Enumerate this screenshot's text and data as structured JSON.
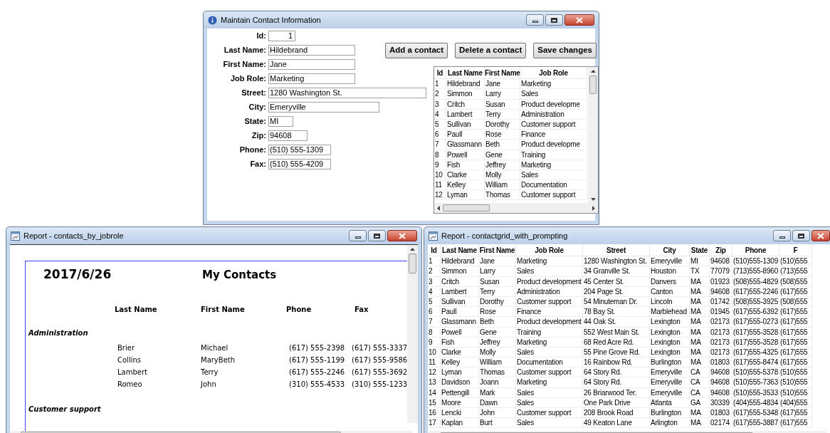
{
  "contact_form": {
    "title": "Maintain Contact Information",
    "fields": [
      {
        "label": "Id:",
        "value": "1",
        "kind": "number"
      },
      {
        "label": "Last Name:",
        "value": "Hildebrand",
        "kind": "text"
      },
      {
        "label": "First Name:",
        "value": "Jane",
        "kind": "text"
      },
      {
        "label": "Job Role:",
        "value": "Marketing",
        "kind": "text"
      },
      {
        "label": "Street:",
        "value": "1280 Washington St.",
        "kind": "text"
      },
      {
        "label": "City:",
        "value": "Emeryville",
        "kind": "text"
      },
      {
        "label": "State:",
        "value": "MI",
        "kind": "text"
      },
      {
        "label": "Zip:",
        "value": "94608",
        "kind": "text"
      },
      {
        "label": "Phone:",
        "value": "(510) 555-1309",
        "kind": "text"
      },
      {
        "label": "Fax:",
        "value": "(510) 555-4209",
        "kind": "text"
      }
    ],
    "buttons": [
      "Add a contact",
      "Delete a contact",
      "Save changes"
    ],
    "grid": {
      "columns": [
        "Id",
        "Last Name",
        "First Name",
        "Job Role"
      ],
      "rows": [
        [
          "1",
          "Hildebrand",
          "Jane",
          "Marketing"
        ],
        [
          "2",
          "Simmon",
          "Larry",
          "Sales"
        ],
        [
          "3",
          "Critch",
          "Susan",
          "Product developme"
        ],
        [
          "4",
          "Lambert",
          "Terry",
          "Administration"
        ],
        [
          "5",
          "Sullivan",
          "Dorothy",
          "Customer support"
        ],
        [
          "6",
          "Paull",
          "Rose",
          "Finance"
        ],
        [
          "7",
          "Glassmann",
          "Beth",
          "Product developme"
        ],
        [
          "8",
          "Powell",
          "Gene",
          "Training"
        ],
        [
          "9",
          "Fish",
          "Jeffrey",
          "Marketing"
        ],
        [
          "10",
          "Clarke",
          "Molly",
          "Sales"
        ],
        [
          "11",
          "Kelley",
          "William",
          "Documentation"
        ],
        [
          "12",
          "Lyman",
          "Thomas",
          "Customer support"
        ]
      ]
    }
  },
  "report_by_jobrole": {
    "title": "Report - contacts_by_jobrole",
    "date": "2017/6/26",
    "heading": "My Contacts",
    "columns": [
      "Last Name",
      "First Name",
      "Phone",
      "Fax"
    ],
    "groups": [
      {
        "name": "Administration",
        "rows": [
          [
            "Brier",
            "Michael",
            "(617) 555-2398",
            "(617) 555-3337"
          ],
          [
            "Collins",
            "MaryBeth",
            "(617) 555-1199",
            "(617) 555-9586"
          ],
          [
            "Lambert",
            "Terry",
            "(617) 555-2246",
            "(617) 555-3692"
          ],
          [
            "Romeo",
            "John",
            "(310) 555-4533",
            "(310) 555-1233"
          ]
        ]
      },
      {
        "name": "Customer support"
      }
    ]
  },
  "report_grid": {
    "title": "Report - contactgrid_with_prompting",
    "columns": [
      "Id",
      "Last Name",
      "First Name",
      "Job Role",
      "Street",
      "City",
      "State",
      "Zip",
      "Phone",
      "F"
    ],
    "rows": [
      [
        "1",
        "Hildebrand",
        "Jane",
        "Marketing",
        "1280 Washington St.",
        "Emeryville",
        "MI",
        "94608",
        "(510)555-1309",
        "(510)555"
      ],
      [
        "2",
        "Simmon",
        "Larry",
        "Sales",
        "34 Granville St.",
        "Houston",
        "TX",
        "77079",
        "(713)555-8960",
        "(713)555"
      ],
      [
        "3",
        "Critch",
        "Susan",
        "Product development",
        "45 Center St.",
        "Danvers",
        "MA",
        "01923",
        "(508)555-4829",
        "(508)555"
      ],
      [
        "4",
        "Lambert",
        "Terry",
        "Administration",
        "204 Page St.",
        "Canton",
        "MA",
        "94608",
        "(617)555-2246",
        "(617)555"
      ],
      [
        "5",
        "Sullivan",
        "Dorothy",
        "Customer support",
        "54 Minuteman Dr.",
        "Lincoln",
        "MA",
        "01742",
        "(508)555-3925",
        "(508)555"
      ],
      [
        "6",
        "Paull",
        "Rose",
        "Finance",
        "78 Bay St.",
        "Marblehead",
        "MA",
        "01945",
        "(617)555-6392",
        "(617)555"
      ],
      [
        "7",
        "Glassmann",
        "Beth",
        "Product development",
        "44 Oak St.",
        "Lexington",
        "MA",
        "02173",
        "(617)555-0273",
        "(617)555"
      ],
      [
        "8",
        "Powell",
        "Gene",
        "Training",
        "552 West Main St.",
        "Lexington",
        "MA",
        "02173",
        "(617)555-3528",
        "(617)555"
      ],
      [
        "9",
        "Fish",
        "Jeffrey",
        "Marketing",
        "68 Red Acre Rd.",
        "Lexington",
        "MA",
        "02173",
        "(617)555-3528",
        "(617)555"
      ],
      [
        "10",
        "Clarke",
        "Molly",
        "Sales",
        "55 Pine Grove Rd.",
        "Lexington",
        "MA",
        "02173",
        "(617)555-4325",
        "(617)555"
      ],
      [
        "11",
        "Kelley",
        "William",
        "Documentation",
        "16 Rainbow Rd.",
        "Burlington",
        "MA",
        "01803",
        "(617)555-8474",
        "(617)555"
      ],
      [
        "12",
        "Lyman",
        "Thomas",
        "Customer support",
        "64 Story Rd.",
        "Emeryville",
        "CA",
        "94608",
        "(510)555-5378",
        "(510)555"
      ],
      [
        "13",
        "Davidson",
        "Joann",
        "Marketing",
        "64 Story Rd.",
        "Emeryville",
        "CA",
        "94608",
        "(510)555-7363",
        "(510)555"
      ],
      [
        "14",
        "Pettengill",
        "Mark",
        "Sales",
        "26 Briarwood Ter.",
        "Emeryville",
        "CA",
        "94608",
        "(510)555-3533",
        "(510)555"
      ],
      [
        "15",
        "Moore",
        "Dawn",
        "Sales",
        "One Park Drive",
        "Atlanta",
        "GA",
        "30339",
        "(404)555-4834",
        "(404)555"
      ],
      [
        "16",
        "Lencki",
        "John",
        "Customer support",
        "208 Brook Road",
        "Burlington",
        "MA",
        "01803",
        "(617)555-5348",
        "(617)555"
      ],
      [
        "17",
        "Kaplan",
        "Burt",
        "Sales",
        "49 Keaton Lane",
        "Arlington",
        "MA",
        "02174",
        "(617)555-3887",
        "(617)555"
      ]
    ]
  }
}
